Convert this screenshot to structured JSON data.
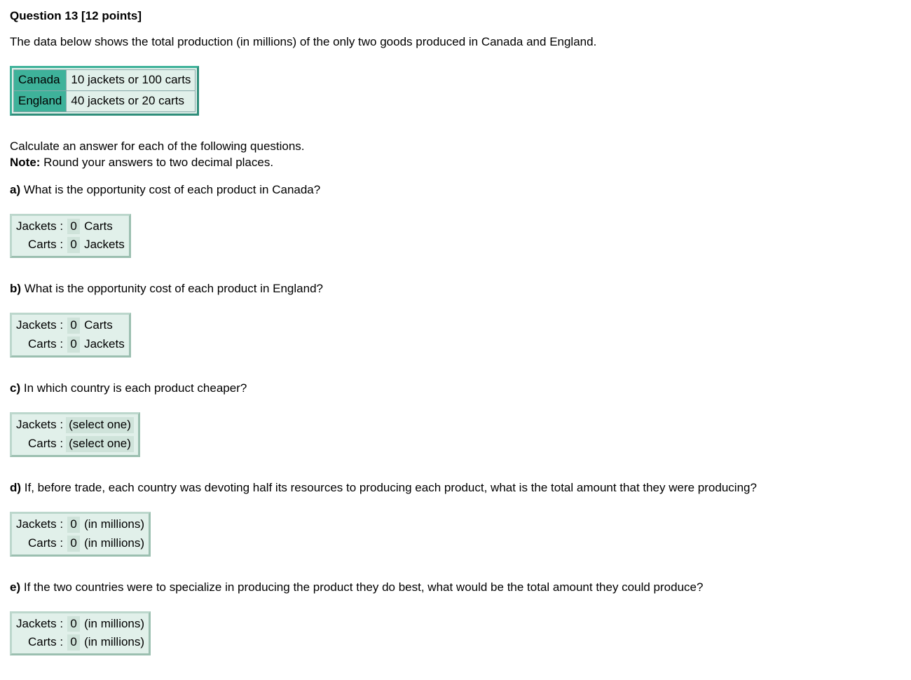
{
  "header": {
    "question_label": "Question 13",
    "points_label": "[12 points]"
  },
  "intro": "The data below shows the total production (in millions) of the only two goods produced in Canada and England.",
  "production_table": {
    "rows": [
      {
        "country": "Canada",
        "text": "10 jackets or 100 carts"
      },
      {
        "country": "England",
        "text": "40 jackets or  20  carts"
      }
    ]
  },
  "instructions": {
    "line1": "Calculate an answer for each of the following questions.",
    "note_label": "Note:",
    "note_text": " Round your answers to two decimal places."
  },
  "parts": {
    "a": {
      "label": "a)",
      "text": " What is the opportunity cost of each product in Canada?",
      "rows": [
        {
          "label": "Jackets :",
          "value": "0",
          "unit": "Carts"
        },
        {
          "label": "Carts :",
          "value": "0",
          "unit": "Jackets"
        }
      ]
    },
    "b": {
      "label": "b)",
      "text": " What is the opportunity cost of each product in England?",
      "rows": [
        {
          "label": "Jackets :",
          "value": "0",
          "unit": "Carts"
        },
        {
          "label": "Carts :",
          "value": "0",
          "unit": "Jackets"
        }
      ]
    },
    "c": {
      "label": "c)",
      "text": " In which country is each product cheaper?",
      "rows": [
        {
          "label": "Jackets :",
          "value": "(select one)"
        },
        {
          "label": "Carts :",
          "value": "(select one)"
        }
      ]
    },
    "d": {
      "label": "d)",
      "text": " If, before trade, each country was devoting half its resources to producing each product, what is the total amount that they were producing?",
      "rows": [
        {
          "label": "Jackets :",
          "value": "0",
          "unit": "(in millions)"
        },
        {
          "label": "Carts :",
          "value": "0",
          "unit": "(in millions)"
        }
      ]
    },
    "e": {
      "label": "e)",
      "text": " If the two countries were to specialize in producing the product they do best, what would be the total amount they could produce?",
      "rows": [
        {
          "label": "Jackets :",
          "value": "0",
          "unit": "(in millions)"
        },
        {
          "label": "Carts :",
          "value": "0",
          "unit": "(in millions)"
        }
      ]
    }
  }
}
